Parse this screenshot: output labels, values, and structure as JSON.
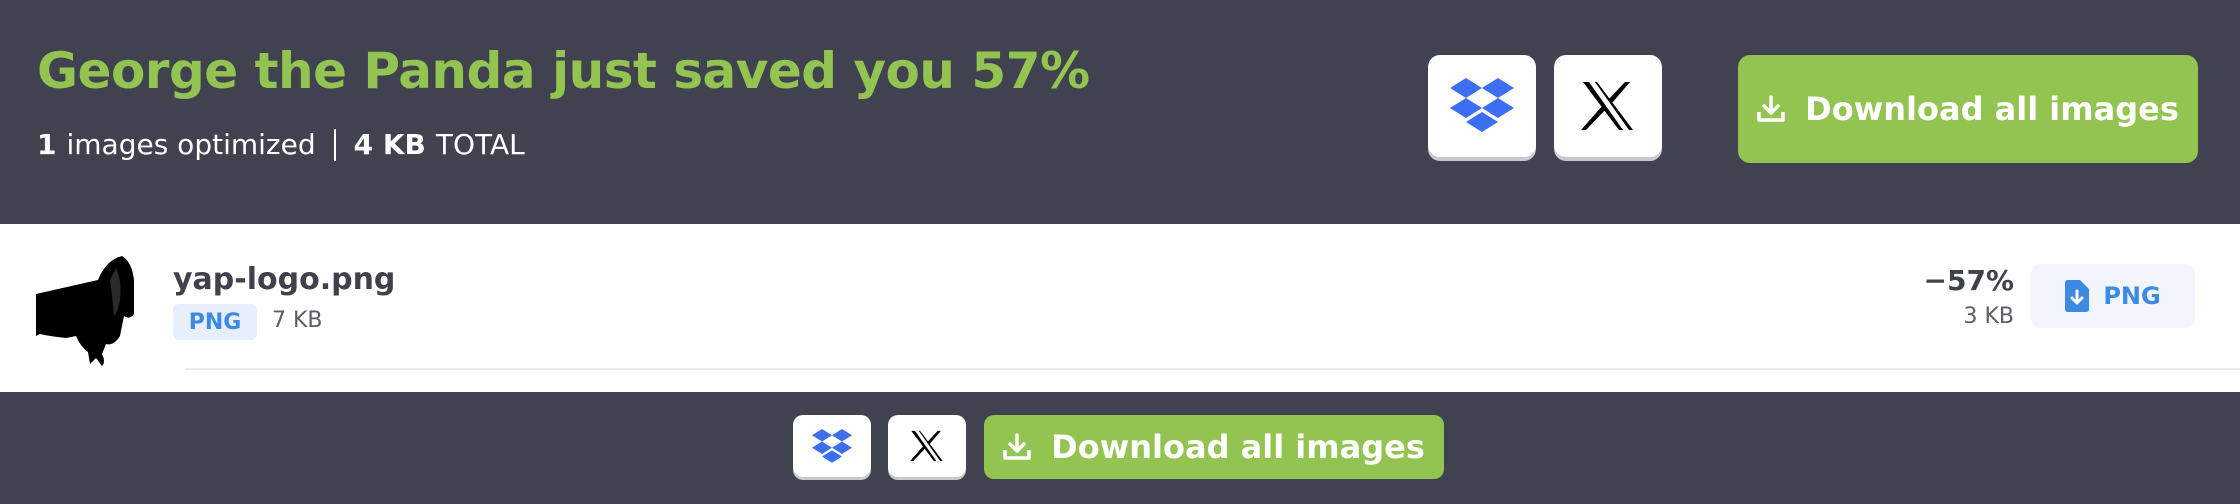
{
  "summary": {
    "headline": "George the Panda just saved you 57%",
    "images_count": "1",
    "images_label": "images optimized",
    "total_size": "4 KB",
    "total_label": "TOTAL"
  },
  "actions": {
    "dropbox": "dropbox-icon",
    "x_share": "x-icon",
    "download_all_label": "Download all images"
  },
  "files": [
    {
      "name": "yap-logo.png",
      "format": "PNG",
      "original_size": "7 KB",
      "saving": "−57%",
      "new_size": "3 KB",
      "download_format": "PNG"
    }
  ],
  "colors": {
    "header_bg": "#40434f",
    "accent_green": "#93c452",
    "badge_blue": "#3c8ae3",
    "dropbox_blue": "#3d6ef0"
  }
}
